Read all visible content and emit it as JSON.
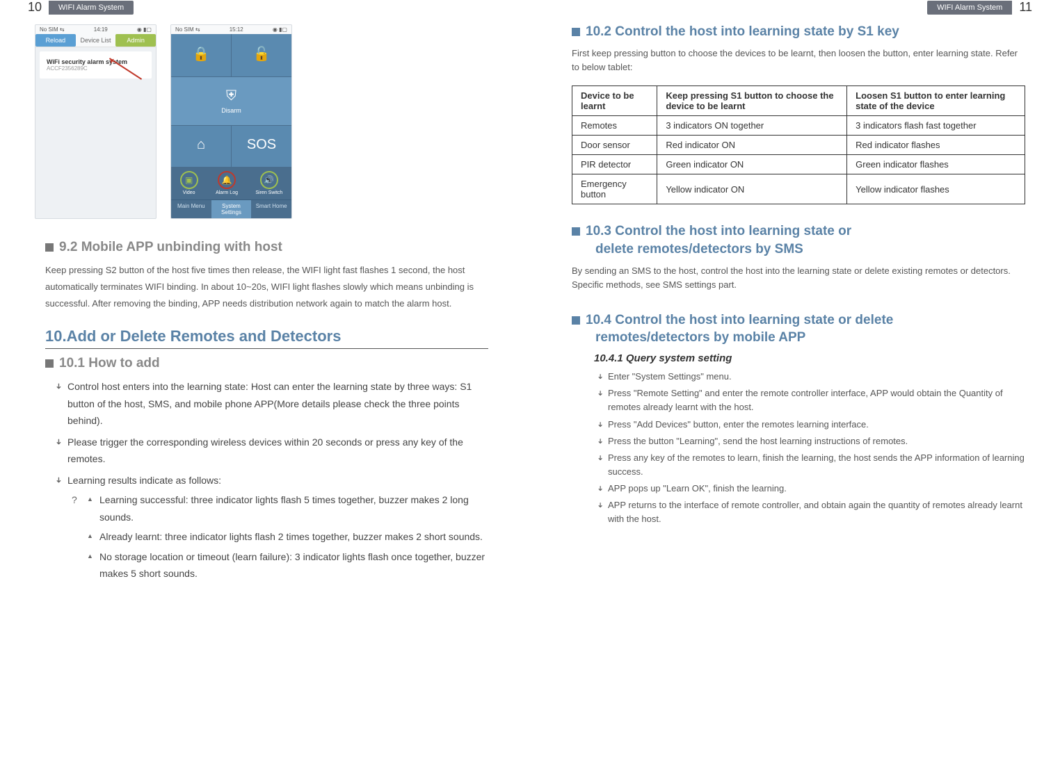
{
  "header": {
    "leftNum": "10",
    "rightNum": "11",
    "tab": "WIFI Alarm System"
  },
  "phone1": {
    "statusLeft": "No SIM ⇆",
    "statusTime": "14:19",
    "tab1": "Reload",
    "tab2": "Device List",
    "tab3": "Admin",
    "devTitle": "WiFi security alarm system",
    "devSub": "ACCF2356289C"
  },
  "phone2": {
    "statusLeft": "No SIM ⇆",
    "statusTime": "15:12",
    "tileDisarm": "Disarm",
    "tileSOS": "SOS",
    "circ1": "Video",
    "circ2": "Alarm Log",
    "circ3": "Siren Switch",
    "bt1": "Main Menu",
    "bt2": "System Settings",
    "bt3": "Smart Home"
  },
  "s92": {
    "title": "9.2 Mobile APP unbinding with host",
    "body": "Keep pressing S2 button of the host five times then release, the WIFI light fast flashes 1 second, the host automatically terminates WIFI binding. In about 10~20s, WIFI light flashes slowly which means unbinding is successful. After removing the binding, APP needs distribution network again to match the alarm host."
  },
  "s10": {
    "title": "10.Add or Delete Remotes and Detectors"
  },
  "s101": {
    "title": "10.1 How to add",
    "b1": "Control host enters into the learning state: Host can enter the learning state by three ways: S1 button of the host, SMS, and mobile phone APP(More details please check the three points behind).",
    "b2": "Please trigger the corresponding wireless devices within 20 seconds or press any key of the remotes.",
    "b3": "Learning results indicate as follows:",
    "sb1": "Learning successful: three indicator lights flash 5 times together, buzzer makes 2 long sounds.",
    "sb2": "Already learnt: three indicator lights flash 2 times together, buzzer makes 2 short sounds.",
    "sb3": "No storage location or timeout (learn failure): 3 indicator lights flash once together, buzzer makes 5 short sounds."
  },
  "s102": {
    "title": "10.2 Control the host into learning state by S1 key",
    "body": "First keep pressing button to choose the devices to be learnt, then loosen the button, enter learning state. Refer to below tablet:",
    "th1": "Device to be learnt",
    "th2": "Keep pressing S1 button to choose the device to be learnt",
    "th3": "Loosen S1 button to enter learning state of the device",
    "r1c1": "Remotes",
    "r1c2": "3 indicators ON together",
    "r1c3": "3 indicators flash fast together",
    "r2c1": "Door sensor",
    "r2c2": "Red indicator ON",
    "r2c3": "Red indicator flashes",
    "r3c1": "PIR detector",
    "r3c2": "Green indicator ON",
    "r3c3": "Green indicator flashes",
    "r4c1": "Emergency button",
    "r4c2": "Yellow indicator ON",
    "r4c3": "Yellow indicator flashes"
  },
  "s103": {
    "titleA": "10.3 Control the host into learning state or",
    "titleB": "delete remotes/detectors by SMS",
    "body": "By sending an SMS to the host, control the host into the learning state or delete existing remotes or detectors. Specific methods, see SMS settings part."
  },
  "s104": {
    "titleA": "10.4 Control the host into learning state or delete",
    "titleB": "remotes/detectors by mobile APP",
    "sub": "10.4.1 Query system setting",
    "st1": "Enter \"System Settings\" menu.",
    "st2": "Press \"Remote Setting\" and enter the remote controller interface, APP would obtain the Quantity of remotes already learnt with the host.",
    "st3": "Press \"Add Devices\" button, enter the remotes learning interface.",
    "st4": "Press the button \"Learning\", send the host learning instructions of remotes.",
    "st5": "Press any key of the remotes to learn, finish the learning, the host sends the APP information of learning success.",
    "st6": "APP pops up \"Learn OK\", finish the learning.",
    "st7": "APP returns to the interface of remote controller, and obtain again the quantity of remotes already learnt with the host."
  }
}
